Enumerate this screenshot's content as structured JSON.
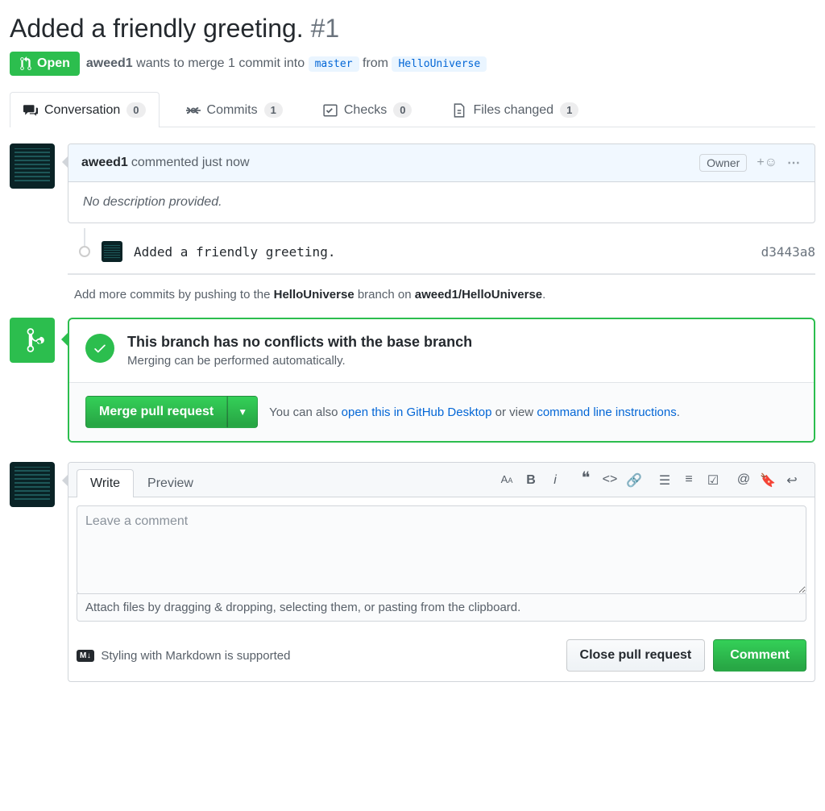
{
  "pr": {
    "title": "Added a friendly greeting.",
    "number": "#1",
    "state": "Open",
    "author": "aweed1",
    "merge_text_1": "wants to merge 1 commit into",
    "base_branch": "master",
    "merge_text_2": "from",
    "head_branch": "HelloUniverse"
  },
  "tabs": {
    "conversation": {
      "label": "Conversation",
      "count": "0"
    },
    "commits": {
      "label": "Commits",
      "count": "1"
    },
    "checks": {
      "label": "Checks",
      "count": "0"
    },
    "files": {
      "label": "Files changed",
      "count": "1"
    }
  },
  "comment": {
    "author": "aweed1",
    "action": "commented just now",
    "owner_label": "Owner",
    "body": "No description provided."
  },
  "commit": {
    "message": "Added a friendly greeting.",
    "sha": "d3443a8"
  },
  "push_hint": {
    "prefix": "Add more commits by pushing to the ",
    "branch": "HelloUniverse",
    "middle": " branch on ",
    "repo": "aweed1/HelloUniverse",
    "suffix": "."
  },
  "merge": {
    "title": "This branch has no conflicts with the base branch",
    "subtitle": "Merging can be performed automatically.",
    "button": "Merge pull request",
    "also_prefix": "You can also ",
    "desktop_link": "open this in GitHub Desktop",
    "also_middle": " or view ",
    "cli_link": "command line instructions",
    "also_suffix": "."
  },
  "form": {
    "write_tab": "Write",
    "preview_tab": "Preview",
    "placeholder": "Leave a comment",
    "attach_hint": "Attach files by dragging & dropping, selecting them, or pasting from the clipboard.",
    "markdown_hint": "Styling with Markdown is supported",
    "markdown_badge": "M↓",
    "close_button": "Close pull request",
    "comment_button": "Comment"
  }
}
